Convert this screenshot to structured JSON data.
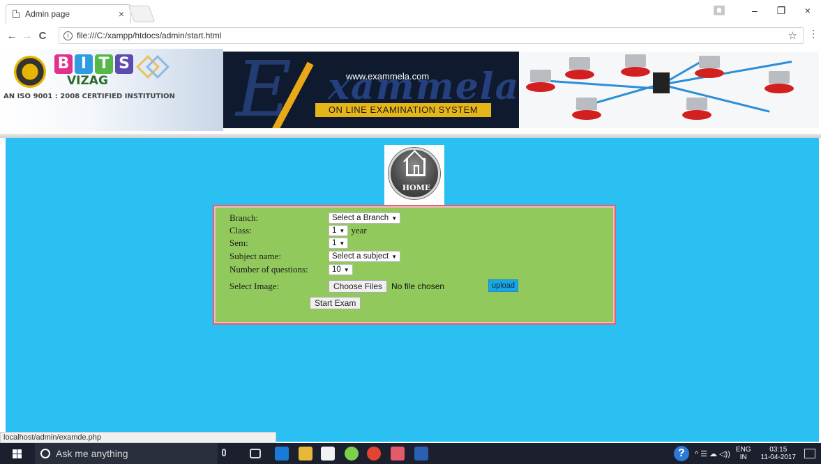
{
  "browser": {
    "tab_title": "Admin page",
    "tab_close": "×",
    "url": "file:///C:/xampp/htdocs/admin/start.html",
    "info_glyph": "i",
    "back": "←",
    "forward": "→",
    "reload": "C",
    "star": "☆",
    "menu": "⋮",
    "minimize": "–",
    "restore": "❐",
    "close": "×"
  },
  "banner": {
    "bits_letters": [
      "B",
      "I",
      "T",
      "S"
    ],
    "bits_colors": [
      "#e0328d",
      "#2f9be0",
      "#56b848",
      "#5d4bb0"
    ],
    "vizag": "VIZAG",
    "iso": "AN ISO 9001 : 2008 CERTIFIED INSTITUTION",
    "big_e": "E",
    "script": "xammela",
    "site_url": "www.exammela.com",
    "tagline": "ON LINE EXAMINATION SYSTEM"
  },
  "home": {
    "label": "HOME"
  },
  "form": {
    "rows": [
      {
        "label": "Branch:",
        "value": "Select a Branch"
      },
      {
        "label": "Class:",
        "value": "1",
        "suffix": "year"
      },
      {
        "label": "Sem:",
        "value": "1"
      },
      {
        "label": "Subject name:",
        "value": "Select a subject"
      },
      {
        "label": "Number of questions:",
        "value": "10"
      },
      {
        "label": "Select Image:",
        "button": "Choose Files",
        "status": "No file chosen",
        "upload": "upload"
      }
    ],
    "caret": "▼",
    "start_button": "Start Exam"
  },
  "status_url": "localhost/admin/examde.php",
  "taskbar": {
    "search_placeholder": "Ask me anything",
    "help": "?",
    "tray_symbols": "^  ☰  ☁  ◁))",
    "lang_top": "ENG",
    "lang_bottom": "IN",
    "time": "03:15",
    "date": "11-04-2017"
  }
}
